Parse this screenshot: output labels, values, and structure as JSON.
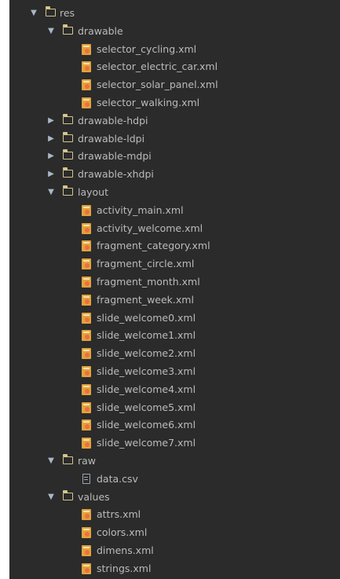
{
  "project_tree": {
    "root": {
      "label": "res",
      "expanded": true,
      "icon": "folder-icon"
    },
    "folders": {
      "drawable": {
        "label": "drawable",
        "expanded": true,
        "files": [
          "selector_cycling.xml",
          "selector_electric_car.xml",
          "selector_solar_panel.xml",
          "selector_walking.xml"
        ]
      },
      "drawable_hdpi": {
        "label": "drawable-hdpi",
        "expanded": false
      },
      "drawable_ldpi": {
        "label": "drawable-ldpi",
        "expanded": false
      },
      "drawable_mdpi": {
        "label": "drawable-mdpi",
        "expanded": false
      },
      "drawable_xhdpi": {
        "label": "drawable-xhdpi",
        "expanded": false
      },
      "layout": {
        "label": "layout",
        "expanded": true,
        "files": [
          "activity_main.xml",
          "activity_welcome.xml",
          "fragment_category.xml",
          "fragment_circle.xml",
          "fragment_month.xml",
          "fragment_week.xml",
          "slide_welcome0.xml",
          "slide_welcome1.xml",
          "slide_welcome2.xml",
          "slide_welcome3.xml",
          "slide_welcome4.xml",
          "slide_welcome5.xml",
          "slide_welcome6.xml",
          "slide_welcome7.xml"
        ]
      },
      "raw": {
        "label": "raw",
        "expanded": true,
        "files": [
          "data.csv"
        ]
      },
      "values": {
        "label": "values",
        "expanded": true,
        "files": [
          "attrs.xml",
          "colors.xml",
          "dimens.xml",
          "strings.xml"
        ]
      }
    },
    "glyphs": {
      "expanded_arrow": "▼",
      "collapsed_arrow": "▶"
    },
    "colors": {
      "panel_background": "#2b2b2b",
      "text": "#bbbbbb",
      "folder_icon": "#d6c58b",
      "xml_icon": "#e0a33e",
      "arrow": "#a9b7c6"
    }
  }
}
